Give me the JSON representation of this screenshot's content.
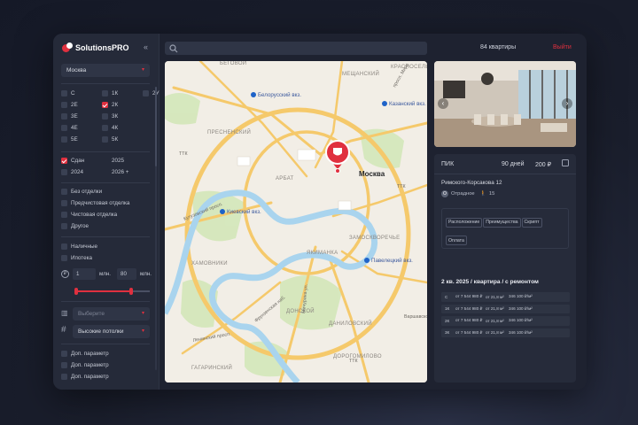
{
  "app": {
    "brand": "SolutionsPRO"
  },
  "sidebar": {
    "city": "Москва",
    "rooms": [
      [
        "С",
        "1К",
        "2У"
      ],
      [
        "2Е",
        "2К",
        ""
      ],
      [
        "3Е",
        "3К",
        ""
      ],
      [
        "4Е",
        "4К",
        ""
      ],
      [
        "5Е",
        "5К",
        ""
      ]
    ],
    "rooms_checked": "2К",
    "delivery": [
      [
        "Сдан",
        "2025"
      ],
      [
        "2024",
        "2026 +"
      ]
    ],
    "delivery_checked": "Сдан",
    "finish": [
      "Без отделки",
      "Предчистовая отделка",
      "Чистовая отделка",
      "Другое"
    ],
    "payment": [
      "Наличные",
      "Ипотека"
    ],
    "price": {
      "from": "1",
      "from_unit": "млн.",
      "to": "80",
      "to_unit": "млн.",
      "from_fraction": 0.0,
      "to_fraction": 0.75
    },
    "select1_placeholder": "Выберите",
    "select2_value": "Высокие потолки",
    "extra_params": [
      "Доп. параметр",
      "Доп. параметр",
      "Доп. параметр"
    ]
  },
  "top": {
    "count": "84 квартиры",
    "exit": "Выйти"
  },
  "map": {
    "pin_label": "Москва",
    "districts": [
      "КРАСНОСЕЛЬСКИЙ",
      "БЕГОВОЙ",
      "МЕЩАНСКИЙ",
      "ПРЕСНЕНСКИЙ",
      "АРБАТ",
      "ЗАМОСКВОРЕЧЬЕ",
      "ХАМОВНИКИ",
      "ЯКИМАНКА",
      "ДОНСКОЙ",
      "ДАНИЛОВСКИЙ",
      "ГАГАРИНСКИЙ",
      "ДОРОГОМИЛОВО"
    ],
    "stations": [
      "Белорусский вкз.",
      "Казанский вкз.",
      "Киевский вкз.",
      "Павелецкий вкз."
    ],
    "roads": [
      "Кутузовский просп.",
      "Фрунзенская наб.",
      "Ленинский просп.",
      "ТТК",
      "ТТК",
      "ТТК",
      "Варшавское ш.",
      "просп. Мира",
      "Мичурина ул."
    ]
  },
  "card": {
    "developer": "ПИК",
    "days": "90 дней",
    "price": "200 ₽",
    "address": "Римского-Корсакова 12",
    "metro_letter": "О",
    "metro": "Отрадное",
    "walk": "15",
    "tags": [
      "Расположение",
      "Преимущества",
      "Скрипт",
      "Оплата"
    ],
    "heading": "2 кв. 2025 / квартира / с ремонтом",
    "rows": [
      [
        "С",
        "от 7 544 980 ₽",
        "от 21,8 м²",
        "346 100 ₽/м²"
      ],
      [
        "1К",
        "от 7 544 980 ₽",
        "от 21,8 м²",
        "346 100 ₽/м²"
      ],
      [
        "2К",
        "от 7 544 980 ₽",
        "от 21,8 м²",
        "346 100 ₽/м²"
      ],
      [
        "3К",
        "от 7 544 980 ₽",
        "от 21,8 м²",
        "346 100 ₽/м²"
      ]
    ]
  },
  "colors": {
    "accent": "#e0303f",
    "panel": "#252a39",
    "bg": "#1e2230",
    "river": "#a9d4ee",
    "road": "#f5c96b",
    "park": "#d3e7b9"
  }
}
